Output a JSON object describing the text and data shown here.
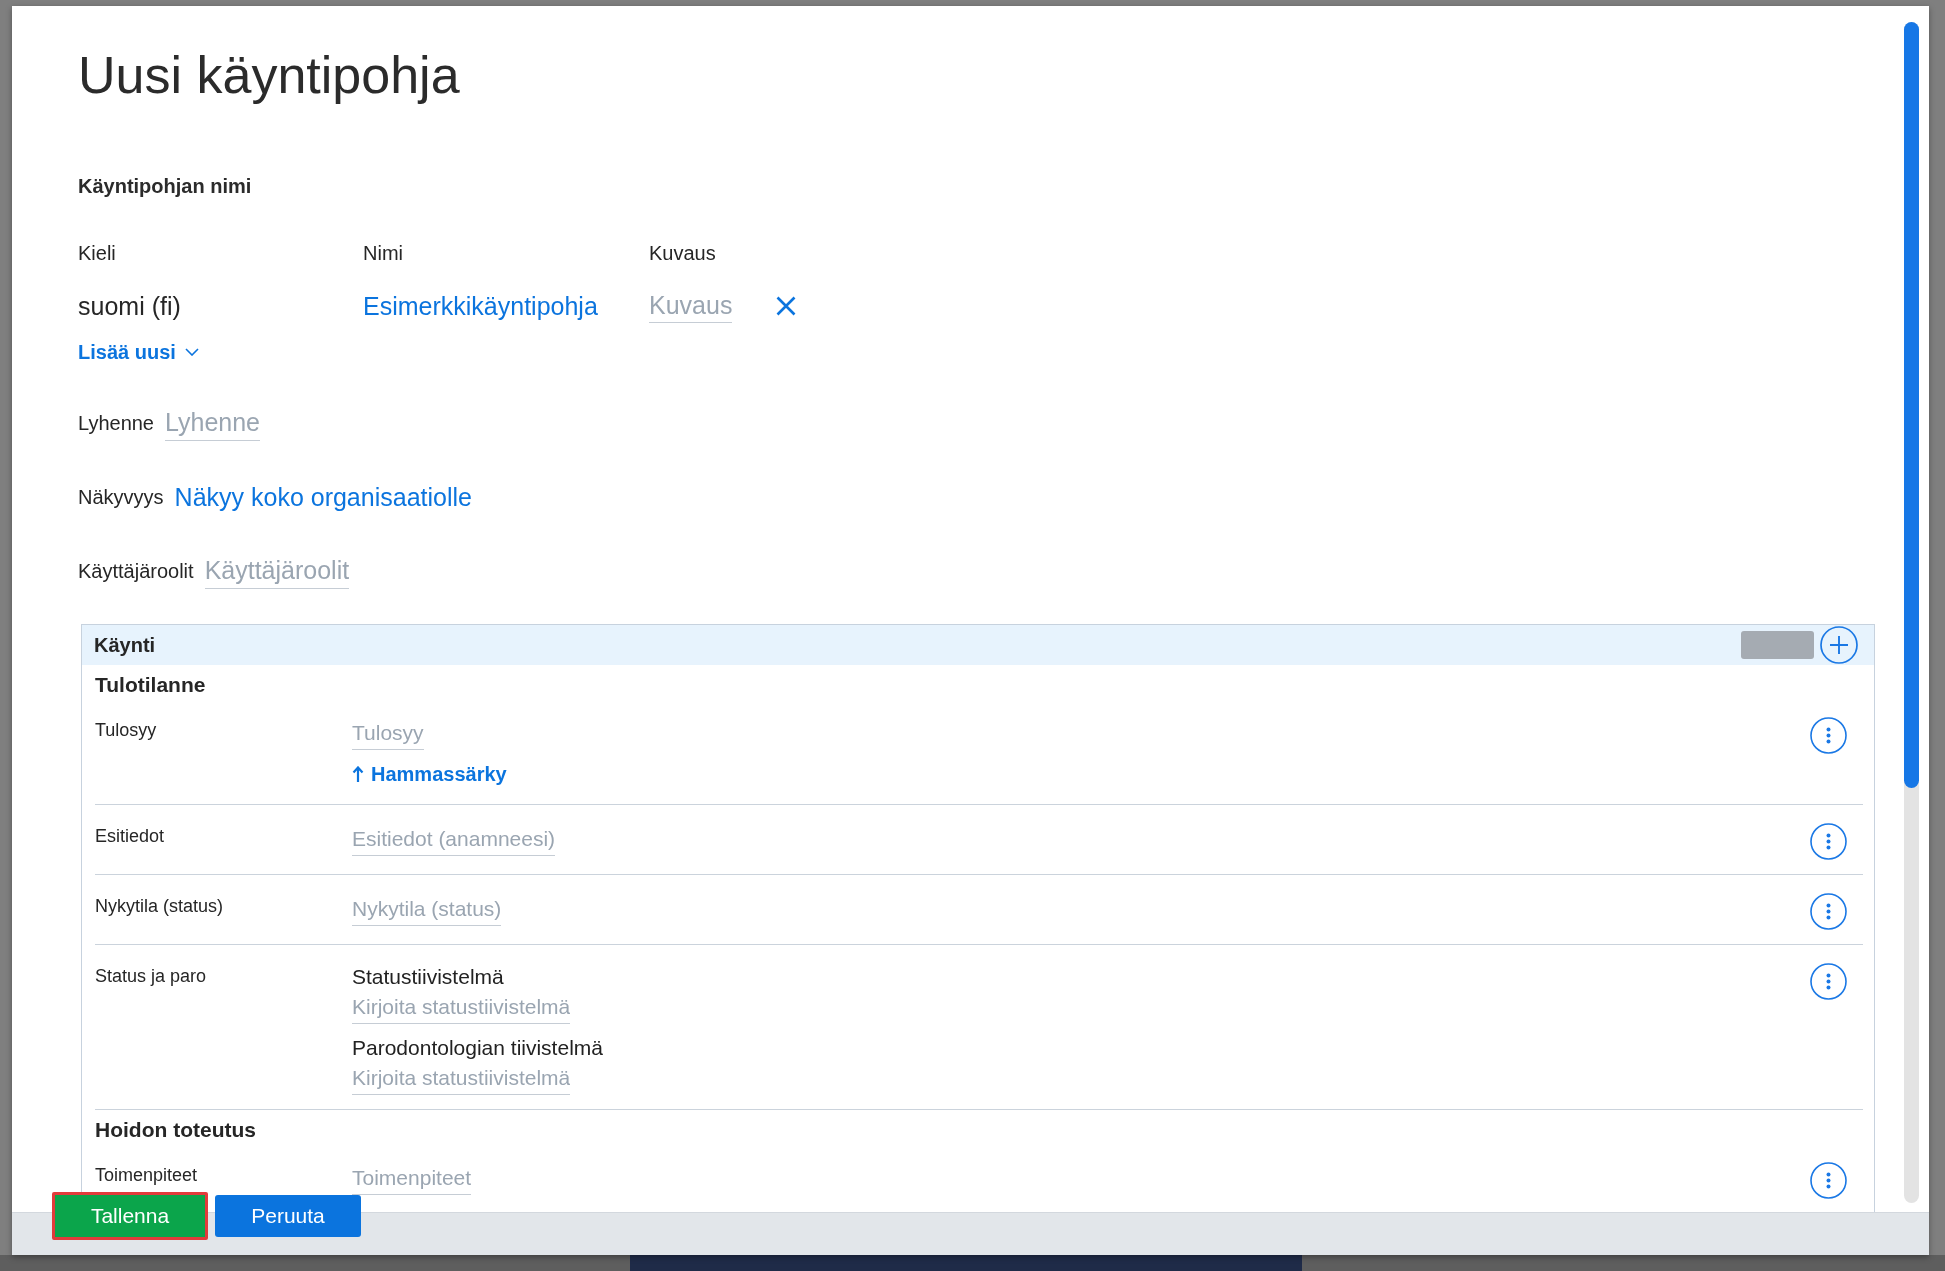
{
  "dialog": {
    "title": "Uusi käyntipohja"
  },
  "name_section": {
    "heading": "Käyntipohjan nimi",
    "columns": [
      "Kieli",
      "Nimi",
      "Kuvaus"
    ],
    "rows": [
      {
        "language": "suomi (fi)",
        "name": "Esimerkkikäyntipohja",
        "description": {
          "placeholder": "Kuvaus"
        }
      }
    ],
    "add_new": "Lisää uusi"
  },
  "fields": [
    {
      "label": "Lyhenne",
      "kind": "input",
      "placeholder": "Lyhenne"
    },
    {
      "label": "Näkyvyys",
      "kind": "link",
      "value": "Näkyy koko organisaatiolle"
    },
    {
      "label": "Käyttäjäroolit",
      "kind": "input",
      "placeholder": "Käyttäjäroolit"
    }
  ],
  "panel": {
    "title": "Käynti",
    "sections": [
      {
        "heading": "Tulotilanne",
        "rows": [
          {
            "label": "Tulosyy",
            "items": [
              {
                "kind": "input",
                "placeholder": "Tulosyy"
              },
              {
                "kind": "link",
                "text": "Hammassärky"
              }
            ]
          },
          {
            "label": "Esitiedot",
            "items": [
              {
                "kind": "input",
                "placeholder": "Esitiedot (anamneesi)"
              }
            ]
          },
          {
            "label": "Nykytila (status)",
            "items": [
              {
                "kind": "input",
                "placeholder": "Nykytila (status)"
              }
            ]
          },
          {
            "label": "Status ja paro",
            "items": [
              {
                "kind": "subheading",
                "text": "Statustiivistelmä"
              },
              {
                "kind": "input",
                "placeholder": "Kirjoita statustiivistelmä"
              },
              {
                "kind": "subheading",
                "text": "Parodontologian tiivistelmä"
              },
              {
                "kind": "input",
                "placeholder": "Kirjoita statustiivistelmä"
              }
            ]
          }
        ]
      },
      {
        "heading": "Hoidon toteutus",
        "rows": [
          {
            "label": "Toimenpiteet",
            "items": [
              {
                "kind": "input",
                "placeholder": "Toimenpiteet"
              }
            ]
          }
        ]
      }
    ]
  },
  "footer": {
    "buttons": [
      {
        "label": "Tallenna",
        "kind": "primary",
        "focused": true
      },
      {
        "label": "Peruuta",
        "kind": "secondary",
        "focused": false
      }
    ]
  }
}
